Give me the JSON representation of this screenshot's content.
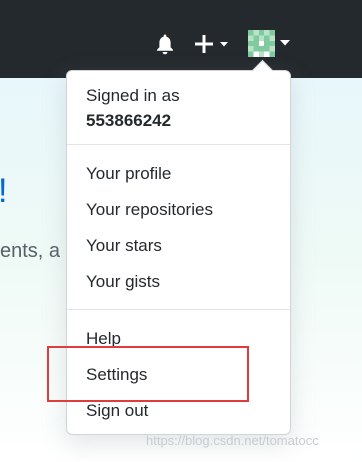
{
  "header": {
    "notifications_icon": "bell-icon",
    "create_icon": "plus-icon",
    "avatar_icon": "identicon"
  },
  "background": {
    "heading_fragment": "!",
    "text_fragment": "ents, a"
  },
  "user_menu": {
    "signed_in_label": "Signed in as",
    "username": "553866242",
    "items_group1": [
      {
        "label": "Your profile"
      },
      {
        "label": "Your repositories"
      },
      {
        "label": "Your stars"
      },
      {
        "label": "Your gists"
      }
    ],
    "items_group2": [
      {
        "label": "Help"
      },
      {
        "label": "Settings"
      },
      {
        "label": "Sign out"
      }
    ]
  },
  "annotation": {
    "highlight_color": "#e03c3c"
  },
  "watermark": "https://blog.csdn.net/tomatocc",
  "colors": {
    "header_bg": "#24292e",
    "link_blue": "#0366d6",
    "identicon_green": "#7fca9f"
  }
}
